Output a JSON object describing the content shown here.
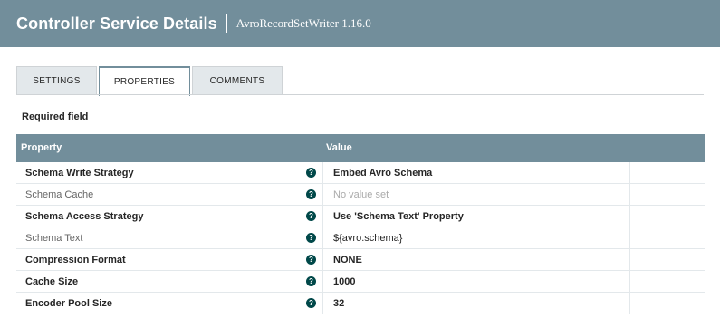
{
  "header": {
    "title": "Controller Service Details",
    "subtitle": "AvroRecordSetWriter 1.16.0"
  },
  "tabs": [
    {
      "label": "SETTINGS",
      "active": false
    },
    {
      "label": "PROPERTIES",
      "active": true
    },
    {
      "label": "COMMENTS",
      "active": false
    }
  ],
  "required_label": "Required field",
  "grid": {
    "columns": {
      "property": "Property",
      "value": "Value"
    },
    "rows": [
      {
        "name": "Schema Write Strategy",
        "value": "Embed Avro Schema",
        "required": true
      },
      {
        "name": "Schema Cache",
        "value": "No value set",
        "required": false,
        "empty": true
      },
      {
        "name": "Schema Access Strategy",
        "value": "Use 'Schema Text' Property",
        "required": true
      },
      {
        "name": "Schema Text",
        "value": "${avro.schema}",
        "required": false
      },
      {
        "name": "Compression Format",
        "value": "NONE",
        "required": true
      },
      {
        "name": "Cache Size",
        "value": "1000",
        "required": true
      },
      {
        "name": "Encoder Pool Size",
        "value": "32",
        "required": true
      }
    ],
    "help_glyph": "?",
    "help_icon": "question-circle-icon"
  },
  "colors": {
    "header_bg": "#728e9b",
    "help_icon": "#004849",
    "placeholder_text": "#aaaaaa"
  }
}
